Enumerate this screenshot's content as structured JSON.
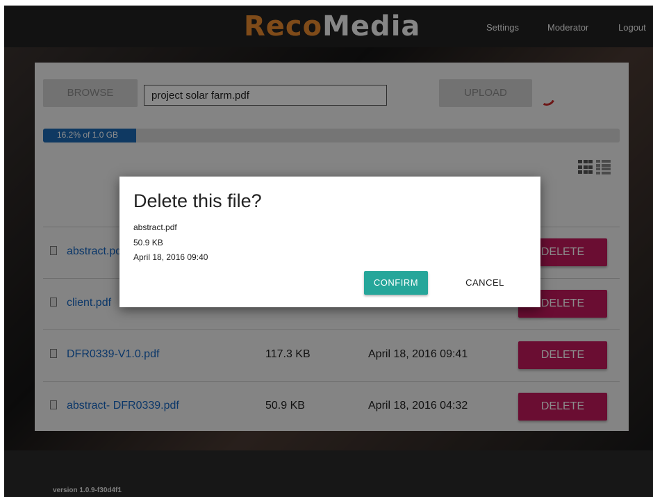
{
  "header": {
    "logo_part1": "Reco",
    "logo_part2": "Media",
    "nav": {
      "settings": "Settings",
      "moderator": "Moderator",
      "logout": "Logout"
    }
  },
  "upload": {
    "browse_label": "BROWSE",
    "filename": "project solar farm.pdf",
    "upload_label": "UPLOAD"
  },
  "storage": {
    "label": "16.2% of 1.0 GB",
    "used_fraction": 0.162
  },
  "files": [
    {
      "name": "abstract.pdf",
      "size": "",
      "date": "",
      "delete_label": "DELETE"
    },
    {
      "name": "client.pdf",
      "size": "",
      "date": "",
      "delete_label": "DELETE"
    },
    {
      "name": "DFR0339-V1.0.pdf",
      "size": "117.3 KB",
      "date": "April 18, 2016 09:41",
      "delete_label": "DELETE"
    },
    {
      "name": "abstract- DFR0339.pdf",
      "size": "50.9 KB",
      "date": "April 18, 2016 04:32",
      "delete_label": "DELETE"
    }
  ],
  "dialog": {
    "title": "Delete this file?",
    "filename": "abstract.pdf",
    "size": "50.9 KB",
    "date": "April 18, 2016 09:40",
    "confirm_label": "CONFIRM",
    "cancel_label": "CANCEL"
  },
  "footer": {
    "version": "version 1.0.9-f30d4f1"
  },
  "colors": {
    "delete": "#c2185b",
    "confirm": "#26a69a",
    "storage_fill": "#1c68b3",
    "logo_accent": "#e7892f",
    "link": "#1565c0"
  },
  "icons": [
    "file-icon",
    "grid-view-icon",
    "list-view-icon",
    "loading-spinner-icon"
  ]
}
